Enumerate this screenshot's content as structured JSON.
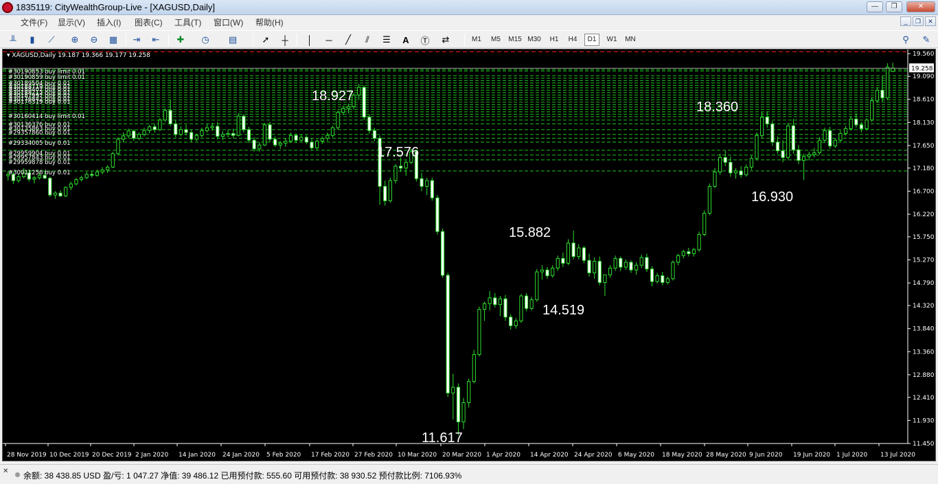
{
  "window": {
    "title": "1835119: CityWealthGroup-Live - [XAGUSD,Daily]",
    "minimize": "—",
    "maximize": "❐",
    "close": "✕"
  },
  "menu": [
    "文件(F)",
    "显示(V)",
    "插入(I)",
    "图表(C)",
    "工具(T)",
    "窗口(W)",
    "帮助(H)"
  ],
  "timeframes": [
    "M1",
    "M5",
    "M15",
    "M30",
    "H1",
    "H4",
    "D1",
    "W1",
    "MN"
  ],
  "active_timeframe": "D1",
  "toolbar_icons": [
    "bar-chart-icon",
    "candlestick-icon",
    "line-chart-icon",
    "zoom-in-icon",
    "zoom-out-icon",
    "tile-windows-icon",
    "autoscroll-icon",
    "chart-shift-icon",
    "indicators-icon",
    "periods-icon",
    "templates-icon",
    "cursor-icon",
    "crosshair-icon",
    "vertical-line-icon",
    "horizontal-line-icon",
    "trendline-icon",
    "equidistant-channel-icon",
    "fibonacci-icon",
    "text-icon",
    "text-label-icon",
    "arrows-icon",
    "search-icon",
    "community-icon"
  ],
  "chart_data": {
    "type": "candlestick",
    "symbol_header": "XAGUSD,Daily",
    "ohlc_header": "19.187 19.366 19.177 19.258",
    "current_price": "19.258",
    "price_ticks": [
      "19.560",
      "19.090",
      "18.610",
      "18.130",
      "17.650",
      "17.180",
      "16.700",
      "16.220",
      "15.750",
      "15.270",
      "14.790",
      "14.320",
      "13.840",
      "13.360",
      "12.880",
      "12.410",
      "11.930",
      "11.450"
    ],
    "date_ticks": [
      "28 Nov 2019",
      "10 Dec 2019",
      "20 Dec 2019",
      "2 Jan 2020",
      "14 Jan 2020",
      "24 Jan 2020",
      "5 Feb 2020",
      "17 Feb 2020",
      "27 Feb 2020",
      "10 Mar 2020",
      "20 Mar 2020",
      "1 Apr 2020",
      "14 Apr 2020",
      "24 Apr 2020",
      "6 May 2020",
      "18 May 2020",
      "28 May 2020",
      "9 Jun 2020",
      "19 Jun 2020",
      "1 Jul 2020",
      "13 Jul 2020"
    ],
    "annotations": [
      "18.927",
      "17.576",
      "11.617",
      "15.882",
      "14.519",
      "18.360",
      "16.930"
    ],
    "order_labels": [
      "#30190853 buy limit 0.01",
      "#30190859 buy limit 0.01",
      "#30189504 buy 0.01",
      "#30188719 buy 0.01",
      "#30188402 buy 0.01",
      "#30188212 buy 0.01",
      "#30187997 buy 0.01",
      "#30176842 buy 0.01",
      "#30176319 buy 0.01",
      "#30160414 buy limit 0.01",
      "#30136376 buy 0.01",
      "#30135863 buy 0.01",
      "#29357860 buy 0.01",
      "#29334005 buy 0.01",
      "#29959904 buy 0.01",
      "#29957843 buy 0.01",
      "#29959878 buy 0.01",
      "#30011256 buy 0.01"
    ],
    "order_levels": [
      19.23,
      19.2,
      19.1,
      19.05,
      19.0,
      18.95,
      18.9,
      18.85,
      18.8,
      18.75,
      18.7,
      18.65,
      18.6,
      18.55,
      18.5,
      18.45,
      18.4,
      18.35,
      18.3,
      18.25,
      18.18,
      18.1,
      17.98,
      17.88,
      17.8,
      17.72,
      17.55,
      17.45,
      17.35,
      17.12
    ],
    "stop_level": 19.6,
    "y_range": [
      11.45,
      19.62
    ],
    "x_visible_bars": 168,
    "candles": [
      [
        17.02,
        17.12,
        16.92,
        17.05
      ],
      [
        17.05,
        17.1,
        16.85,
        16.92
      ],
      [
        16.92,
        17.06,
        16.88,
        17.0
      ],
      [
        17.0,
        17.18,
        16.97,
        17.08
      ],
      [
        17.08,
        17.15,
        16.9,
        16.95
      ],
      [
        16.95,
        17.02,
        16.86,
        16.98
      ],
      [
        16.98,
        17.08,
        16.94,
        17.03
      ],
      [
        17.03,
        17.12,
        16.95,
        16.97
      ],
      [
        16.97,
        17.0,
        16.58,
        16.62
      ],
      [
        16.62,
        16.7,
        16.54,
        16.66
      ],
      [
        16.66,
        16.72,
        16.58,
        16.6
      ],
      [
        16.6,
        16.8,
        16.58,
        16.78
      ],
      [
        16.78,
        16.9,
        16.72,
        16.85
      ],
      [
        16.85,
        16.98,
        16.82,
        16.94
      ],
      [
        16.94,
        17.02,
        16.9,
        16.98
      ],
      [
        16.98,
        17.1,
        16.95,
        17.05
      ],
      [
        17.05,
        17.12,
        16.98,
        17.03
      ],
      [
        17.03,
        17.15,
        17.0,
        17.1
      ],
      [
        17.1,
        17.2,
        17.05,
        17.14
      ],
      [
        17.14,
        17.24,
        17.08,
        17.2
      ],
      [
        17.2,
        17.52,
        17.18,
        17.48
      ],
      [
        17.48,
        17.82,
        17.45,
        17.78
      ],
      [
        17.78,
        17.92,
        17.72,
        17.85
      ],
      [
        17.85,
        18.0,
        17.8,
        17.95
      ],
      [
        17.95,
        17.98,
        17.75,
        17.8
      ],
      [
        17.8,
        17.92,
        17.76,
        17.88
      ],
      [
        17.88,
        18.02,
        17.84,
        17.96
      ],
      [
        17.96,
        18.08,
        17.9,
        18.04
      ],
      [
        18.04,
        18.1,
        17.92,
        17.98
      ],
      [
        17.98,
        18.22,
        17.95,
        18.18
      ],
      [
        18.18,
        18.42,
        18.14,
        18.38
      ],
      [
        18.38,
        18.6,
        18.05,
        18.1
      ],
      [
        18.1,
        18.18,
        17.82,
        17.88
      ],
      [
        17.88,
        18.05,
        17.84,
        17.98
      ],
      [
        17.98,
        18.08,
        17.86,
        17.92
      ],
      [
        17.92,
        17.98,
        17.72,
        17.78
      ],
      [
        17.78,
        17.9,
        17.74,
        17.86
      ],
      [
        17.86,
        18.02,
        17.82,
        17.96
      ],
      [
        17.96,
        18.1,
        17.92,
        18.02
      ],
      [
        18.02,
        18.12,
        17.95,
        18.05
      ],
      [
        18.05,
        18.14,
        17.78,
        17.84
      ],
      [
        17.84,
        17.95,
        17.76,
        17.88
      ],
      [
        17.88,
        17.98,
        17.82,
        17.9
      ],
      [
        17.9,
        18.0,
        17.8,
        17.86
      ],
      [
        17.86,
        18.32,
        17.84,
        18.26
      ],
      [
        18.26,
        18.3,
        17.92,
        17.98
      ],
      [
        17.98,
        18.04,
        17.7,
        17.76
      ],
      [
        17.76,
        17.82,
        17.52,
        17.58
      ],
      [
        17.58,
        17.72,
        17.52,
        17.66
      ],
      [
        17.66,
        18.12,
        17.64,
        18.08
      ],
      [
        18.08,
        18.14,
        17.72,
        17.78
      ],
      [
        17.78,
        17.84,
        17.62,
        17.66
      ],
      [
        17.66,
        17.74,
        17.58,
        17.7
      ],
      [
        17.7,
        17.8,
        17.62,
        17.74
      ],
      [
        17.74,
        17.92,
        17.7,
        17.86
      ],
      [
        17.86,
        17.9,
        17.7,
        17.76
      ],
      [
        17.76,
        17.88,
        17.72,
        17.82
      ],
      [
        17.82,
        17.86,
        17.68,
        17.72
      ],
      [
        17.72,
        17.8,
        17.56,
        17.6
      ],
      [
        17.6,
        17.78,
        17.56,
        17.74
      ],
      [
        17.74,
        17.84,
        17.68,
        17.8
      ],
      [
        17.8,
        17.92,
        17.74,
        17.86
      ],
      [
        17.86,
        18.06,
        17.82,
        18.02
      ],
      [
        18.02,
        18.38,
        17.98,
        18.34
      ],
      [
        18.34,
        18.48,
        18.28,
        18.42
      ],
      [
        18.42,
        18.52,
        18.32,
        18.46
      ],
      [
        18.46,
        18.74,
        18.4,
        18.7
      ],
      [
        18.7,
        18.93,
        18.6,
        18.86
      ],
      [
        18.86,
        18.9,
        18.18,
        18.24
      ],
      [
        18.24,
        18.3,
        17.9,
        17.96
      ],
      [
        17.96,
        18.02,
        17.74,
        17.8
      ],
      [
        17.8,
        17.86,
        16.42,
        16.8
      ],
      [
        16.8,
        16.92,
        16.4,
        16.5
      ],
      [
        16.5,
        16.98,
        16.46,
        16.92
      ],
      [
        16.92,
        17.26,
        16.86,
        17.22
      ],
      [
        17.22,
        17.4,
        17.1,
        17.18
      ],
      [
        17.18,
        17.34,
        17.02,
        17.3
      ],
      [
        17.3,
        17.58,
        17.26,
        17.52
      ],
      [
        17.52,
        17.56,
        16.9,
        16.96
      ],
      [
        16.96,
        17.08,
        16.7,
        16.8
      ],
      [
        16.8,
        16.98,
        16.62,
        16.92
      ],
      [
        16.92,
        16.98,
        16.5,
        16.56
      ],
      [
        16.56,
        16.62,
        15.8,
        15.86
      ],
      [
        15.86,
        15.92,
        14.9,
        14.95
      ],
      [
        14.95,
        15.0,
        12.42,
        12.5
      ],
      [
        12.5,
        12.9,
        11.95,
        12.62
      ],
      [
        12.62,
        12.7,
        11.62,
        11.9
      ],
      [
        11.9,
        12.4,
        11.75,
        12.3
      ],
      [
        12.3,
        12.8,
        12.2,
        12.74
      ],
      [
        12.74,
        13.4,
        12.7,
        13.3
      ],
      [
        13.3,
        14.3,
        13.26,
        14.24
      ],
      [
        14.24,
        14.4,
        14.0,
        14.36
      ],
      [
        14.36,
        14.62,
        14.22,
        14.48
      ],
      [
        14.48,
        14.58,
        14.28,
        14.34
      ],
      [
        14.34,
        14.52,
        14.1,
        14.46
      ],
      [
        14.46,
        14.54,
        14.0,
        14.08
      ],
      [
        14.08,
        14.14,
        13.82,
        13.9
      ],
      [
        13.9,
        14.06,
        13.84,
        14.0
      ],
      [
        14.0,
        14.56,
        13.96,
        14.52
      ],
      [
        14.52,
        14.58,
        14.2,
        14.26
      ],
      [
        14.26,
        14.5,
        14.22,
        14.44
      ],
      [
        14.44,
        15.08,
        14.4,
        15.02
      ],
      [
        15.02,
        15.16,
        14.86,
        15.06
      ],
      [
        15.06,
        15.12,
        14.88,
        14.94
      ],
      [
        14.94,
        15.16,
        14.9,
        15.1
      ],
      [
        15.1,
        15.36,
        15.04,
        15.3
      ],
      [
        15.3,
        15.42,
        15.12,
        15.2
      ],
      [
        15.2,
        15.7,
        15.16,
        15.62
      ],
      [
        15.62,
        15.88,
        15.28,
        15.34
      ],
      [
        15.34,
        15.6,
        15.28,
        15.52
      ],
      [
        15.52,
        15.56,
        15.2,
        15.26
      ],
      [
        15.26,
        15.4,
        14.92,
        15.0
      ],
      [
        15.0,
        15.32,
        14.88,
        15.24
      ],
      [
        15.24,
        15.34,
        14.74,
        14.8
      ],
      [
        14.8,
        14.86,
        14.52,
        14.96
      ],
      [
        14.96,
        15.16,
        14.9,
        15.1
      ],
      [
        15.1,
        15.36,
        15.04,
        15.3
      ],
      [
        15.3,
        15.34,
        15.04,
        15.12
      ],
      [
        15.12,
        15.28,
        15.06,
        15.22
      ],
      [
        15.22,
        15.26,
        15.0,
        15.06
      ],
      [
        15.06,
        15.22,
        14.96,
        15.16
      ],
      [
        15.16,
        15.38,
        15.1,
        15.32
      ],
      [
        15.32,
        15.4,
        15.02,
        15.08
      ],
      [
        15.08,
        15.14,
        14.72,
        14.82
      ],
      [
        14.82,
        15.0,
        14.78,
        14.94
      ],
      [
        14.94,
        15.02,
        14.74,
        14.8
      ],
      [
        14.8,
        14.92,
        14.76,
        14.88
      ],
      [
        14.88,
        15.26,
        14.84,
        15.22
      ],
      [
        15.22,
        15.4,
        15.16,
        15.36
      ],
      [
        15.36,
        15.48,
        15.3,
        15.44
      ],
      [
        15.44,
        15.52,
        15.34,
        15.4
      ],
      [
        15.4,
        15.52,
        15.34,
        15.48
      ],
      [
        15.48,
        15.86,
        15.44,
        15.8
      ],
      [
        15.8,
        16.3,
        15.76,
        16.24
      ],
      [
        16.24,
        16.86,
        16.2,
        16.8
      ],
      [
        16.8,
        17.18,
        16.76,
        17.1
      ],
      [
        17.1,
        17.48,
        17.04,
        17.4
      ],
      [
        17.4,
        17.54,
        17.22,
        17.3
      ],
      [
        17.3,
        17.42,
        17.0,
        17.08
      ],
      [
        17.08,
        17.18,
        16.96,
        17.12
      ],
      [
        17.12,
        17.22,
        16.98,
        17.04
      ],
      [
        17.04,
        17.26,
        17.0,
        17.2
      ],
      [
        17.2,
        17.44,
        17.14,
        17.38
      ],
      [
        17.38,
        17.92,
        17.34,
        17.86
      ],
      [
        17.86,
        18.34,
        17.8,
        18.24
      ],
      [
        18.24,
        18.36,
        18.02,
        18.1
      ],
      [
        18.1,
        18.16,
        17.64,
        17.72
      ],
      [
        17.72,
        17.84,
        17.48,
        17.54
      ],
      [
        17.54,
        17.76,
        17.3,
        17.4
      ],
      [
        17.4,
        18.12,
        17.36,
        18.06
      ],
      [
        18.06,
        18.2,
        17.48,
        17.56
      ],
      [
        17.56,
        17.66,
        17.26,
        17.34
      ],
      [
        17.34,
        17.48,
        16.93,
        17.42
      ],
      [
        17.42,
        17.52,
        17.34,
        17.46
      ],
      [
        17.46,
        17.6,
        17.4,
        17.5
      ]
    ],
    "candles_tail": [
      [
        17.5,
        17.82,
        17.46,
        17.76
      ],
      [
        17.76,
        18.02,
        17.7,
        17.96
      ],
      [
        17.96,
        18.04,
        17.58,
        17.64
      ],
      [
        17.64,
        17.8,
        17.6,
        17.76
      ],
      [
        17.76,
        17.96,
        17.72,
        17.9
      ],
      [
        17.9,
        18.06,
        17.86,
        18.0
      ],
      [
        18.0,
        18.26,
        17.96,
        18.2
      ],
      [
        18.2,
        18.32,
        18.02,
        18.08
      ],
      [
        18.08,
        18.14,
        17.92,
        18.0
      ],
      [
        18.0,
        18.22,
        17.96,
        18.18
      ],
      [
        18.18,
        18.64,
        18.14,
        18.58
      ],
      [
        18.58,
        18.86,
        18.54,
        18.8
      ],
      [
        18.8,
        19.1,
        18.56,
        18.64
      ],
      [
        18.64,
        19.36,
        18.6,
        19.28
      ],
      [
        19.19,
        19.37,
        19.18,
        19.26
      ]
    ]
  },
  "status": {
    "text": "余额: 38 438.85 USD  盈/亏: 1 047.27  净值: 39 486.12  已用预付款: 555.60  可用预付款: 38 930.52  预付款比例: 7106.93%"
  }
}
